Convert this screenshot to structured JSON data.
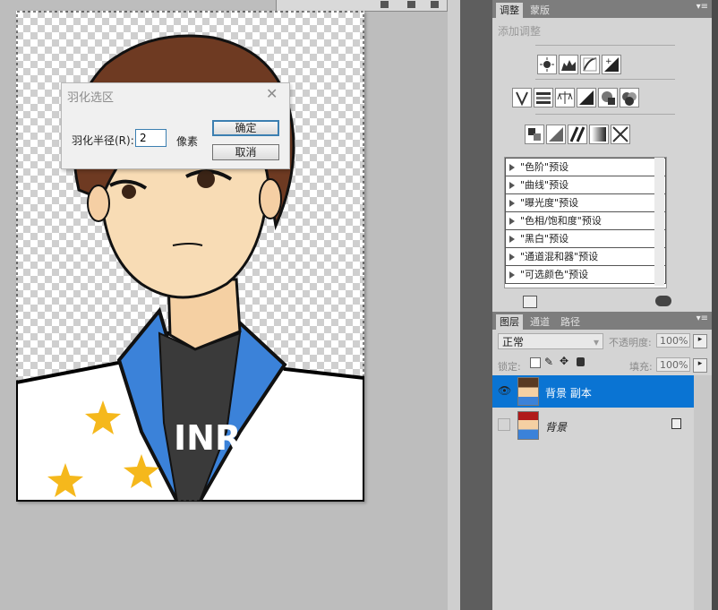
{
  "dialog": {
    "title": "羽化选区",
    "close_glyph": "✕",
    "radius_label": "羽化半径(R):",
    "radius_value": "2",
    "unit_label": "像素",
    "ok_label": "确定",
    "cancel_label": "取消"
  },
  "adjustments_panel": {
    "tabs": [
      "调整",
      "蒙版"
    ],
    "heading": "添加调整",
    "presets": [
      "\"色阶\"预设",
      "\"曲线\"预设",
      "\"曝光度\"预设",
      "\"色相/饱和度\"预设",
      "\"黑白\"预设",
      "\"通道混和器\"预设",
      "\"可选颜色\"预设"
    ]
  },
  "layers_panel": {
    "tabs": [
      "图层",
      "通道",
      "路径"
    ],
    "blend_mode": "正常",
    "opacity_label": "不透明度:",
    "opacity_value": "100%",
    "lock_label": "锁定:",
    "fill_label": "填充:",
    "fill_value": "100%",
    "layers": [
      {
        "name": "背景 副本",
        "selected": true,
        "visible": true
      },
      {
        "name": "背景",
        "selected": false,
        "visible": false,
        "locked": true
      }
    ]
  },
  "colors": {
    "selection_blue": "#0a74d3",
    "panel_bg": "#d4d4d4"
  }
}
